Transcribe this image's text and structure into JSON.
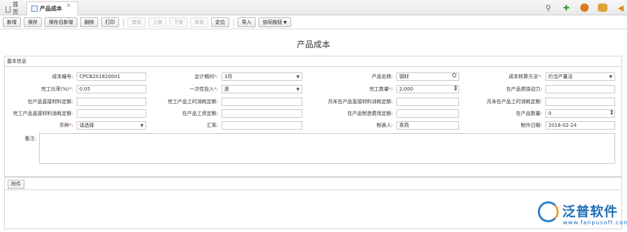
{
  "tabs": {
    "home": "首页",
    "active": "产品成本",
    "close": "×"
  },
  "toolbar": {
    "new": "新增",
    "save": "保存",
    "save_new": "保存且新增",
    "delete": "删除",
    "print": "打印",
    "first": "首张",
    "prev": "上张",
    "next": "下张",
    "last": "末张",
    "locate": "定位",
    "import": "导入",
    "collab": "协同按钮"
  },
  "page": {
    "title": "产品成本",
    "section": "基本信息"
  },
  "form": {
    "row1": {
      "cost_no_label": "成本编号:",
      "cost_no": "CPCB201820001",
      "period_label": "会计期间",
      "period": "3月",
      "product_label": "产品名称:",
      "product": "钢材",
      "method_label": "成本核算方法",
      "method": "约当产量法"
    },
    "row2": {
      "ratio_label": "完工比率(%)",
      "ratio": "0.05",
      "once_label": "一次性投入",
      "once": "是",
      "qty_label": "完工数量",
      "qty": "2,000",
      "fuel_label": "在产品燃烧动力:",
      "fuel": ""
    },
    "row3": {
      "a_label": "在产品直接材料定额:",
      "b_label": "完工产品工时消耗定额:",
      "c_label": "月末在产品直接材料消耗定额:",
      "d_label": "月末在产品工时消耗定额:"
    },
    "row4": {
      "a_label": "完工产品直接材料消耗定额:",
      "b_label": "在产品工资定额:",
      "c_label": "在产品制造费用定额:",
      "d_label": "在产品数量:",
      "d_value": "0"
    },
    "row5": {
      "currency_label": "币种",
      "currency": "请选择",
      "rate_label": "汇率:",
      "maker_label": "制表人:",
      "maker": "章燕",
      "date_label": "制作日期:",
      "date": "2018-02-24"
    },
    "memo_label": "备注:",
    "required_mark": "*",
    "colon": ":"
  },
  "attachment": {
    "label": "附件"
  },
  "watermark": {
    "brand": "泛普软件",
    "url": "www.fanpusoft.com"
  }
}
